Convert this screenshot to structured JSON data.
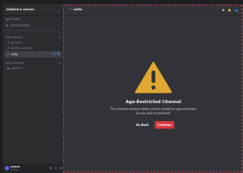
{
  "window": {
    "title": "mallow's server"
  },
  "server": {
    "name": "mallow's server"
  },
  "sidebar": {
    "top_items": [
      {
        "label": "Events",
        "icon": "calendar-icon"
      },
      {
        "label": "Server Boosts",
        "icon": "boost-icon"
      }
    ],
    "categories": [
      {
        "title": "Text Channels",
        "channels": [
          {
            "label": "general"
          },
          {
            "label": "garden-buddies"
          },
          {
            "label": "nsfw",
            "active": true
          }
        ]
      },
      {
        "title": "Voice Channels",
        "channels": [
          {
            "label": "General"
          }
        ]
      }
    ]
  },
  "user": {
    "name": "mallow",
    "status": "Online"
  },
  "channel_header": {
    "name": "nsfw"
  },
  "gate": {
    "title": "Age-Restricted Channel",
    "line1": "This channel contains adult content marked as age-restricted.",
    "line2": "Do you wish to proceed?",
    "back_label": "Go Back",
    "continue_label": "Continue"
  },
  "colors": {
    "accent": "#da373c",
    "warning": "#e0a82e",
    "annotation": "#d9363b"
  }
}
